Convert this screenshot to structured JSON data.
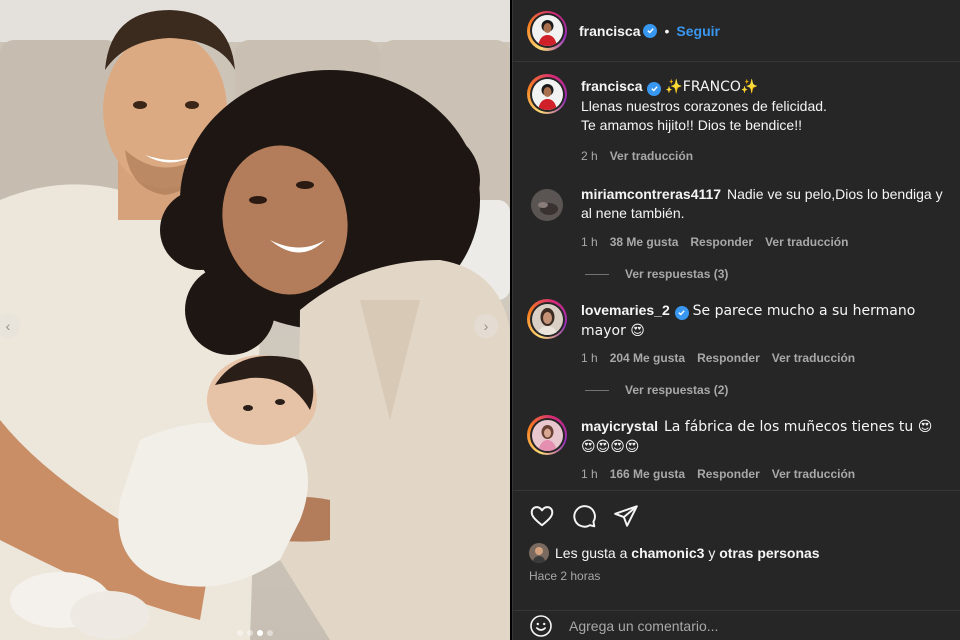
{
  "post_author": {
    "username": "francisca",
    "follow_label": "Seguir",
    "separator": "•"
  },
  "caption": {
    "username": "francisca",
    "text_line1": "✨FRANCO✨",
    "text_line2": "Llenas nuestros corazones de felicidad.",
    "text_line3": "Te amamos hijito!! Dios te bendice!!",
    "time": "2 h",
    "translate": "Ver traducción"
  },
  "comments": [
    {
      "username": "miriamcontreras4117",
      "text": "Nadie ve su pelo,Dios lo bendiga y al nene también.",
      "time": "1 h",
      "likes": "38 Me gusta",
      "reply": "Responder",
      "translate": "Ver traducción",
      "replies_label": "Ver respuestas (3)"
    },
    {
      "username": "lovemaries_2",
      "text": "Se parece mucho a su hermano mayor 😍",
      "time": "1 h",
      "likes": "204 Me gusta",
      "reply": "Responder",
      "translate": "Ver traducción",
      "replies_label": "Ver respuestas (2)"
    },
    {
      "username": "mayicrystal",
      "text": "La fábrica de los muñecos tienes tu 😍😍😍😍😍",
      "time": "1 h",
      "likes": "166 Me gusta",
      "reply": "Responder",
      "translate": "Ver traducción"
    }
  ],
  "likes_summary": {
    "prefix": "Les gusta a",
    "user": "chamonic3",
    "joiner": "y",
    "others": "otras personas"
  },
  "posted_ago": "Hace 2 horas",
  "add_comment": {
    "placeholder": "Agrega un comentario..."
  },
  "carousel": {
    "total": 4,
    "active": 2
  },
  "colors": {
    "panel_bg": "#262626",
    "link_blue": "#3897f0",
    "muted_text": "#a8a8a8"
  },
  "icons": [
    "verified-icon",
    "heart-icon",
    "comment-icon",
    "share-icon",
    "emoji-icon",
    "chevron-left-icon",
    "chevron-right-icon"
  ]
}
